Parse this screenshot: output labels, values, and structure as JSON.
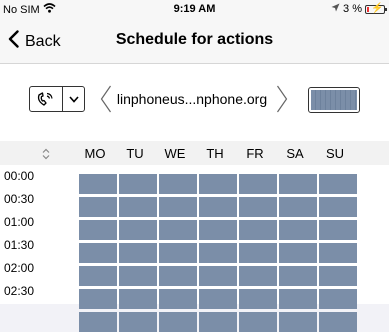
{
  "status_bar": {
    "carrier": "No SIM",
    "time": "9:19 AM",
    "battery_pct": "3 %"
  },
  "nav": {
    "back_label": "Back",
    "title": "Schedule for actions"
  },
  "selector": {
    "account": "linphoneus...nphone.org"
  },
  "schedule": {
    "days": [
      "MO",
      "TU",
      "WE",
      "TH",
      "FR",
      "SA",
      "SU"
    ],
    "times": [
      "00:00",
      "00:30",
      "01:00",
      "01:30",
      "02:00",
      "02:30"
    ]
  },
  "colors": {
    "cell_fill": "#7b8ea8",
    "battery_low": "#e33333"
  },
  "icons": {
    "wifi": "wifi-icon",
    "location": "location-arrow-icon",
    "back": "chevron-left-icon",
    "phone": "phone-ringing-icon",
    "dropdown": "chevron-down-icon",
    "prev": "chevron-left-icon",
    "next": "chevron-right-icon",
    "sort": "sort-updown-icon",
    "battery": "battery-icon"
  }
}
